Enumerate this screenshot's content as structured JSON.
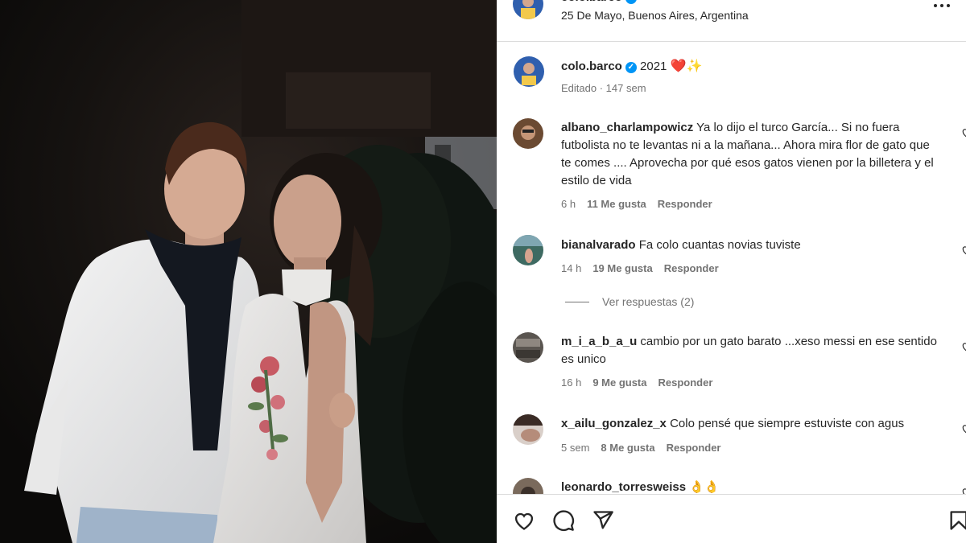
{
  "post": {
    "username": "colo.barco",
    "location": "25 De Mayo, Buenos Aires, Argentina",
    "caption_text": "2021",
    "caption_emojis": "❤️✨",
    "edited_label": "Editado",
    "time": "147 sem"
  },
  "comments": [
    {
      "username": "albano_charlampowicz",
      "text": "Ya lo dijo el turco García... Si no fuera futbolista no te levantas ni a la mañana... Ahora mira flor de gato que te comes .... Aprovecha por qué esos gatos vienen por la billetera y el estilo de vida",
      "time": "6 h",
      "likes": "11 Me gusta",
      "reply": "Responder"
    },
    {
      "username": "bianalvarado",
      "text": "Fa colo cuantas novias tuviste",
      "time": "14 h",
      "likes": "19 Me gusta",
      "reply": "Responder",
      "view_replies": "Ver respuestas (2)"
    },
    {
      "username": "m_i_a_b_a_u",
      "text": "cambio por un gato barato ...xeso messi en ese sentido es unico",
      "time": "16 h",
      "likes": "9 Me gusta",
      "reply": "Responder"
    },
    {
      "username": "x_ailu_gonzalez_x",
      "text": "Colo pensé que siempre estuviste con agus",
      "time": "5 sem",
      "likes": "8 Me gusta",
      "reply": "Responder"
    },
    {
      "username": "leonardo_torresweiss",
      "text": "👌👌"
    }
  ],
  "icons": {
    "like": "heart-icon",
    "comment": "comment-icon",
    "share": "send-icon",
    "save": "bookmark-icon",
    "verified": "verified-badge-icon"
  },
  "colors": {
    "verified": "#0095f6",
    "muted": "#737373",
    "text": "#262626"
  }
}
